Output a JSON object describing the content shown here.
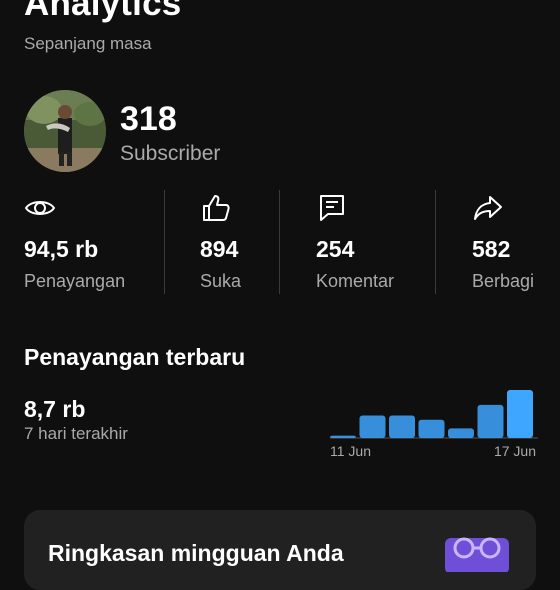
{
  "header": {
    "title": "Analytics",
    "subtitle": "Sepanjang masa"
  },
  "channel": {
    "subscriber_count": "318",
    "subscriber_label": "Subscriber"
  },
  "stats": [
    {
      "icon": "eye-icon",
      "value": "94,5 rb",
      "label": "Penayangan"
    },
    {
      "icon": "thumbs-up-icon",
      "value": "894",
      "label": "Suka"
    },
    {
      "icon": "comment-icon",
      "value": "254",
      "label": "Komentar"
    },
    {
      "icon": "share-icon",
      "value": "582",
      "label": "Berbagi"
    }
  ],
  "recent": {
    "title": "Penayangan terbaru",
    "value": "8,7 rb",
    "period": "7 hari terakhir"
  },
  "chart_data": {
    "type": "bar",
    "x": [
      "11 Jun",
      "12 Jun",
      "13 Jun",
      "14 Jun",
      "15 Jun",
      "16 Jun",
      "17 Jun"
    ],
    "values": [
      0.05,
      0.47,
      0.47,
      0.38,
      0.2,
      0.69,
      1.0
    ],
    "tick_labels": [
      "11 Jun",
      "17 Jun"
    ],
    "bar_color": "#3ea6ff",
    "bar_color_latest": "#3ea6ff"
  },
  "weekly_card": {
    "title": "Ringkasan mingguan Anda",
    "icon": "glasses-icon",
    "icon_color": "#9b7bff"
  },
  "colors": {
    "background": "#0f0f0f",
    "text_secondary": "#aaaaaa",
    "accent": "#3ea6ff"
  }
}
